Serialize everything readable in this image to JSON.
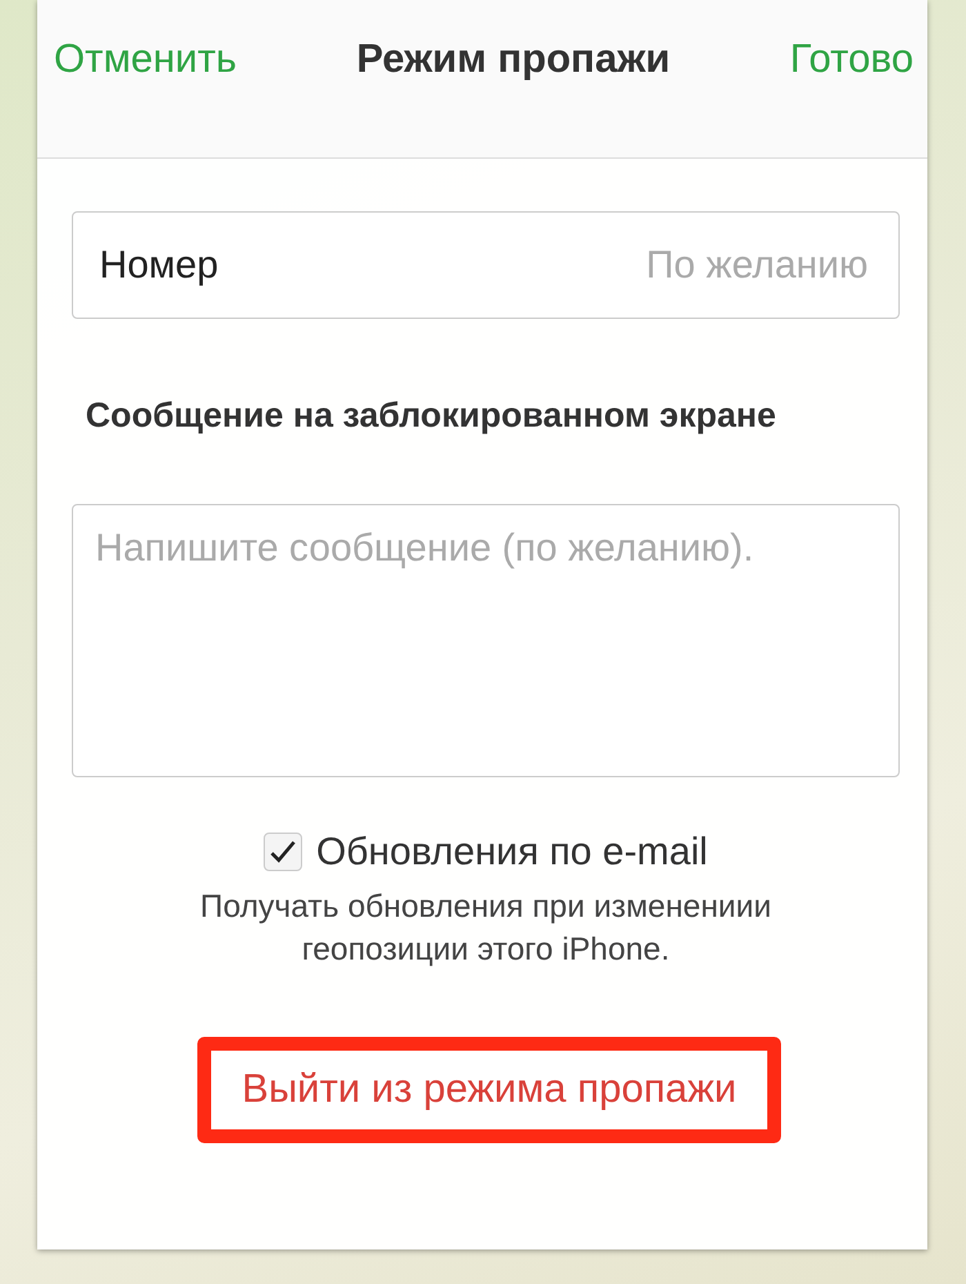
{
  "header": {
    "cancel": "Отменить",
    "title": "Режим пропажи",
    "done": "Готово"
  },
  "phone_field": {
    "label": "Номер",
    "placeholder": "По желанию"
  },
  "message_heading": "Сообщение на заблокированном экране",
  "message_field": {
    "placeholder": "Напишите сообщение (по желанию)."
  },
  "email_updates": {
    "label": "Обновления по e-mail",
    "checked": true,
    "description": "Получать обновления при изменениии геопозиции этого iPhone."
  },
  "exit_button": {
    "label": "Выйти из режима пропажи",
    "highlighted": true
  }
}
